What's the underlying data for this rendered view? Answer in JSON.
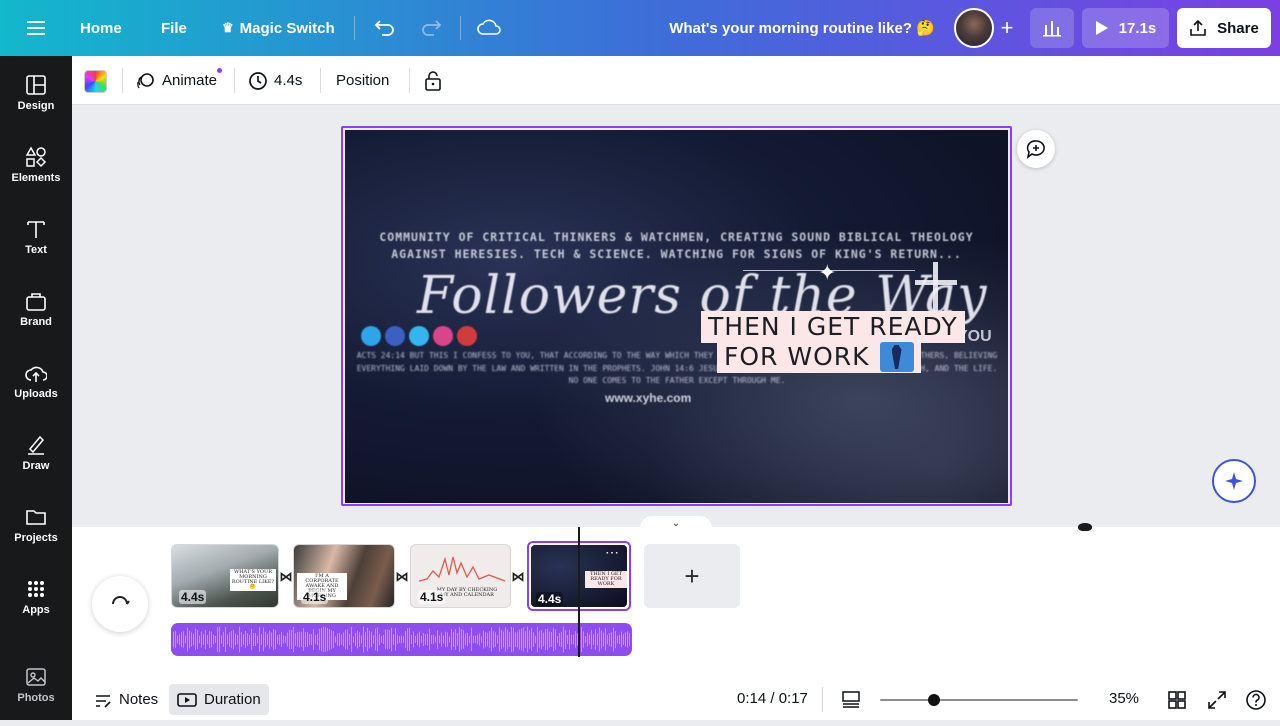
{
  "topbar": {
    "home": "Home",
    "file": "File",
    "magic_switch": "Magic Switch",
    "doc_title": "What's your morning routine like? 🤔",
    "play_duration": "17.1s",
    "share": "Share",
    "gradient_colors": [
      "#12b8cc",
      "#3c6fd8",
      "#7b3fe4"
    ]
  },
  "sidebar": {
    "items": [
      {
        "label": "Design",
        "icon": "design-icon"
      },
      {
        "label": "Elements",
        "icon": "elements-icon"
      },
      {
        "label": "Text",
        "icon": "text-icon"
      },
      {
        "label": "Brand",
        "icon": "brand-icon"
      },
      {
        "label": "Uploads",
        "icon": "upload-icon"
      },
      {
        "label": "Draw",
        "icon": "draw-icon"
      },
      {
        "label": "Projects",
        "icon": "folder-icon"
      },
      {
        "label": "Apps",
        "icon": "apps-grid-icon"
      },
      {
        "label": "Photos",
        "icon": "photo-icon"
      }
    ]
  },
  "toolbar": {
    "animate": "Animate",
    "duration": "4.4s",
    "position": "Position"
  },
  "slide": {
    "line1": "COMMUNITY OF CRITICAL THINKERS & WATCHMEN, CREATING SOUND BIBLICAL THEOLOGY",
    "line2": "AGAINST HERESIES.  TECH & SCIENCE. WATCHING FOR SIGNS OF KING'S RETURN...",
    "script_title": "Followers of the Way",
    "you": "YOU",
    "paragraph": "ACTS 24:14 BUT THIS I CONFESS TO YOU, THAT ACCORDING TO THE WAY WHICH THEY CALL A SECT, SO I WORSHIP THE GOD OF MY FATHERS, BELIEVING EVERYTHING LAID DOWN BY THE LAW AND WRITTEN IN THE PROPHETS. JOHN 14:6 JESUS SAID TO HIM, \"I AM THE WAY, AND THE TRUTH, AND THE LIFE. NO ONE COMES TO THE FATHER EXCEPT THROUGH ME.",
    "website": "www.xyhe.com",
    "caption_line1": "THEN I GET READY",
    "caption_line2": "FOR WORK"
  },
  "timeline": {
    "clips": [
      {
        "duration": "4.4s",
        "caption": "WHAT'S YOUR MORNING ROUTINE LIKE? 🤔"
      },
      {
        "duration": "4.1s",
        "caption": "I'M A CORPORATE AWAKE AND BEGIN MY MORNING"
      },
      {
        "duration": "4.1s",
        "caption": "MY DAY BY CHECKING MY AND CALENDAR"
      },
      {
        "duration": "4.4s",
        "caption": "THEN I GET READY FOR WORK",
        "selected": true
      }
    ],
    "audio_color": "#8f4cf0"
  },
  "footer": {
    "notes": "Notes",
    "duration": "Duration",
    "time": "0:14 / 0:17",
    "zoom": "35%",
    "zoom_fraction": 0.35
  },
  "colors": {
    "accent": "#8b3dff",
    "sidebar_bg": "#18191b",
    "caption_bg": "#fbe7e7"
  }
}
